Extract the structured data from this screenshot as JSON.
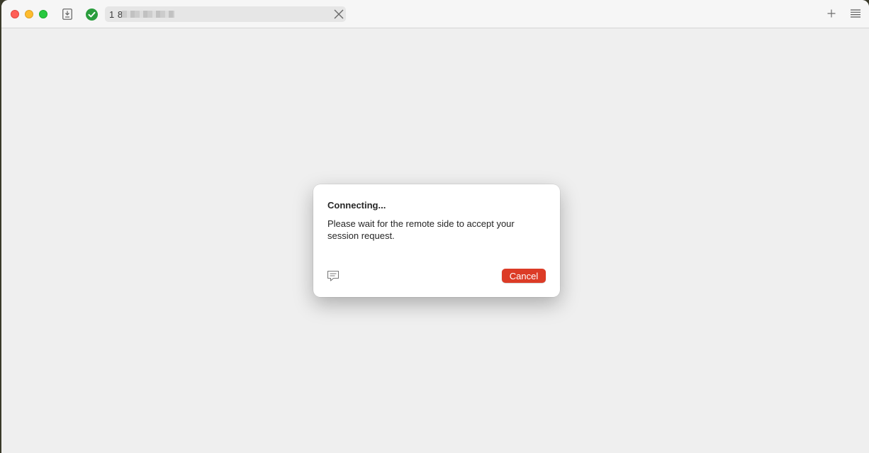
{
  "window": {
    "address": "1 8",
    "icons": {
      "download": "download-icon",
      "status": "checkmark-circle-icon",
      "close_tab": "close-icon",
      "new_tab": "plus-icon",
      "menu": "hamburger-menu-icon"
    },
    "colors": {
      "status_ok": "#2a9d3d",
      "accent_cancel": "#dc3b26"
    }
  },
  "dialog": {
    "title": "Connecting...",
    "message": "Please wait for the remote side to accept your session request.",
    "cancel_label": "Cancel",
    "chat_icon": "chat-icon"
  }
}
